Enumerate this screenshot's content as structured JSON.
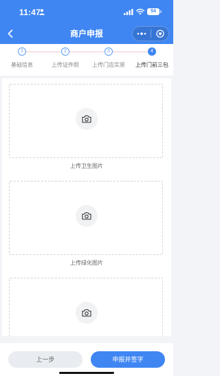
{
  "status_bar": {
    "time": "11:47",
    "battery": "54"
  },
  "nav": {
    "title": "商户申报"
  },
  "steps": [
    {
      "number": "1",
      "label": "基础信息",
      "active": false
    },
    {
      "number": "2",
      "label": "上传证件照",
      "active": false
    },
    {
      "number": "3",
      "label": "上传门店实景",
      "active": false
    },
    {
      "number": "4",
      "label": "上传门前三包",
      "active": true
    }
  ],
  "uploads": [
    {
      "label": "上传卫生图片"
    },
    {
      "label": "上传绿化图片"
    },
    {
      "label": ""
    }
  ],
  "footer": {
    "prev_label": "上一步",
    "submit_label": "申报并签字"
  },
  "colors": {
    "primary": "#3f86f3",
    "step_line": "#f0c9d0",
    "background": "#f3f4f7"
  }
}
